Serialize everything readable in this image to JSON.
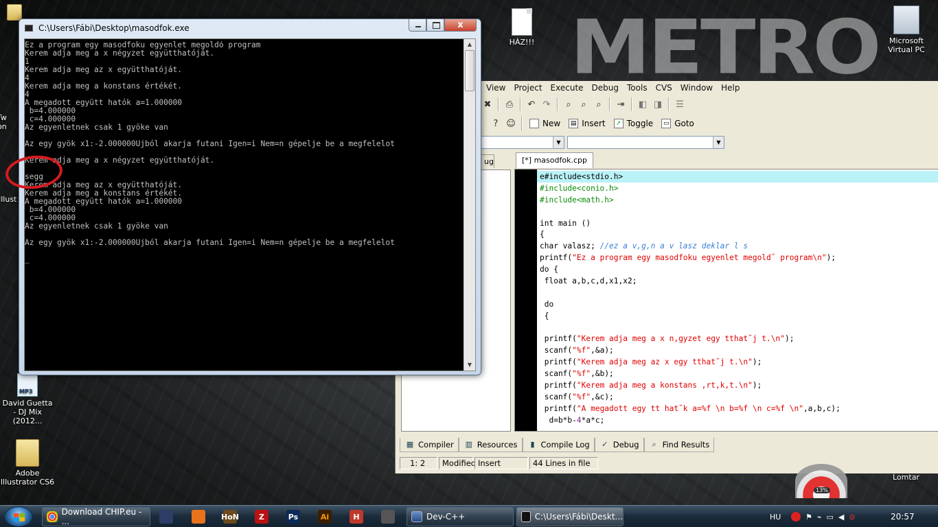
{
  "desktop": {
    "icons": [
      {
        "name": "HÁZ!!!",
        "type": "document"
      },
      {
        "name": "Microsoft Virtual PC",
        "type": "virtual-pc"
      },
      {
        "name": "David Guetta - DJ Mix (2012...",
        "type": "mp3"
      },
      {
        "name": "Adobe Illustrator CS6",
        "type": "folder"
      }
    ],
    "partial_icon_labels": [
      "Tw",
      "on",
      "Illust"
    ],
    "wallpaper_text": "METRO",
    "recycle_bin": {
      "label": "Lomtar",
      "badge": "13%"
    }
  },
  "console": {
    "title": "C:\\Users\\Fábi\\Desktop\\masodfok.exe",
    "close_symbol": "x",
    "lines": [
      "Ez a program egy masodfoku egyenlet megoldó program",
      "Kerem adja meg a x négyzet együtthatóját.",
      "1",
      "Kerem adja meg az x együtthatóját.",
      "4",
      "Kerem adja meg a konstans értékét.",
      "4",
      "A megadott együtt hatók a=1.000000",
      " b=4.000000",
      " c=4.000000",
      "Az egyenletnek csak 1 gyöke van",
      "",
      "Az egy gyök x1:-2.000000Ujból akarja futani Igen=i Nem=n gépelje be a megfelelot",
      "",
      "Kerem adja meg a x négyzet együtthatóját.",
      "",
      "segg",
      "Kerem adja meg az x együtthatóját.",
      "Kerem adja meg a konstans értékét.",
      "A megadott együtt hatók a=1.000000",
      " b=4.000000",
      " c=4.000000",
      "Az egyenletnek csak 1 gyöke van",
      "",
      "Az egy gyök x1:-2.000000Ujból akarja futani Igen=i Nem=n gépelje be a megfelelot",
      "",
      "_"
    ]
  },
  "devcpp": {
    "menu": [
      "View",
      "Project",
      "Execute",
      "Debug",
      "Tools",
      "CVS",
      "Window",
      "Help"
    ],
    "toolbar_labels": {
      "new": "New",
      "insert": "Insert",
      "toggle": "Toggle",
      "goto": "Goto"
    },
    "left_tab": "ug",
    "editor_tab": "[*] masodfok.cpp",
    "code_lines": [
      [
        {
          "t": "e#include<stdio.h>",
          "c": "kw"
        }
      ],
      [
        {
          "t": "#include<conio.h>",
          "c": "pp"
        }
      ],
      [
        {
          "t": "#include<math.h>",
          "c": "pp"
        }
      ],
      [
        {
          "t": "",
          "c": "kw"
        }
      ],
      [
        {
          "t": "int main ()",
          "c": "kw"
        }
      ],
      [
        {
          "t": "{",
          "c": "kw"
        }
      ],
      [
        {
          "t": "char valasz; ",
          "c": "kw"
        },
        {
          "t": "//ez a v,g,n a v lasz deklar l s",
          "c": "cmt"
        }
      ],
      [
        {
          "t": "printf(",
          "c": "kw"
        },
        {
          "t": "\"Ez a program egy masodfoku egyenlet megold˘ program\\n\"",
          "c": "str"
        },
        {
          "t": ");",
          "c": "kw"
        }
      ],
      [
        {
          "t": "do {",
          "c": "kw"
        }
      ],
      [
        {
          "t": " float a,b,c,d,x1,x2;",
          "c": "kw"
        }
      ],
      [
        {
          "t": "",
          "c": "kw"
        }
      ],
      [
        {
          "t": " do",
          "c": "kw"
        }
      ],
      [
        {
          "t": " {",
          "c": "kw"
        }
      ],
      [
        {
          "t": "",
          "c": "kw"
        }
      ],
      [
        {
          "t": " printf(",
          "c": "kw"
        },
        {
          "t": "\"Kerem adja meg a x n,gyzet egy tthat˘j t.\\n\"",
          "c": "str"
        },
        {
          "t": ");",
          "c": "kw"
        }
      ],
      [
        {
          "t": " scanf(",
          "c": "kw"
        },
        {
          "t": "\"%f\"",
          "c": "str"
        },
        {
          "t": ",&a);",
          "c": "kw"
        }
      ],
      [
        {
          "t": " printf(",
          "c": "kw"
        },
        {
          "t": "\"Kerem adja meg az x egy tthat˘j t.\\n\"",
          "c": "str"
        },
        {
          "t": ");",
          "c": "kw"
        }
      ],
      [
        {
          "t": " scanf(",
          "c": "kw"
        },
        {
          "t": "\"%f\"",
          "c": "str"
        },
        {
          "t": ",&b);",
          "c": "kw"
        }
      ],
      [
        {
          "t": " printf(",
          "c": "kw"
        },
        {
          "t": "\"Kerem adja meg a konstans ,rt,k,t.\\n\"",
          "c": "str"
        },
        {
          "t": ");",
          "c": "kw"
        }
      ],
      [
        {
          "t": " scanf(",
          "c": "kw"
        },
        {
          "t": "\"%f\"",
          "c": "str"
        },
        {
          "t": ",&c);",
          "c": "kw"
        }
      ],
      [
        {
          "t": " printf(",
          "c": "kw"
        },
        {
          "t": "\"A megadott egy tt hat˘k a=%f \\n b=%f \\n c=%f \\n\"",
          "c": "str"
        },
        {
          "t": ",a,b,c);",
          "c": "kw"
        }
      ],
      [
        {
          "t": "  d=b*b-",
          "c": "kw"
        },
        {
          "t": "4",
          "c": "num"
        },
        {
          "t": "*a*c;",
          "c": "kw"
        }
      ]
    ],
    "bottom_tabs": [
      "Compiler",
      "Resources",
      "Compile Log",
      "Debug",
      "Find Results"
    ],
    "status": {
      "position": "1: 2",
      "modified": "Modified",
      "mode": "Insert",
      "lines": "44 Lines in file"
    }
  },
  "taskbar": {
    "tasks": [
      {
        "label": "Download CHIP.eu - ...",
        "icon": "chrome-icon"
      },
      {
        "label": "Dev-C++",
        "icon": "devcpp-icon"
      },
      {
        "label": "C:\\Users\\Fábi\\Deskt...",
        "icon": "console-icon"
      }
    ],
    "quick_launch": [
      {
        "name": "save-icon",
        "glyph": ""
      },
      {
        "name": "firefox-icon",
        "glyph": ""
      },
      {
        "name": "hon-icon",
        "glyph": "HoN"
      },
      {
        "name": "filezilla-icon",
        "glyph": "Z"
      },
      {
        "name": "photoshop-icon",
        "glyph": "Ps"
      },
      {
        "name": "illustrator-icon",
        "glyph": "Ai"
      },
      {
        "name": "h-app-icon",
        "glyph": "H"
      },
      {
        "name": "media-icon",
        "glyph": ""
      }
    ],
    "language": "HU",
    "clock": "20:57"
  }
}
